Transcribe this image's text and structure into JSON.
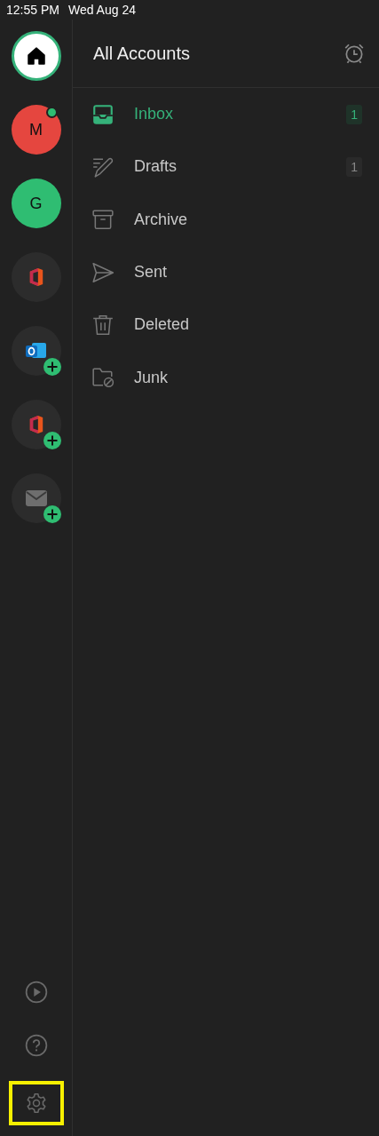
{
  "status_bar": {
    "time": "12:55 PM",
    "date": "Wed Aug 24"
  },
  "accounts": [
    {
      "kind": "home",
      "selected": true,
      "add": false,
      "unread": false
    },
    {
      "kind": "letter",
      "letter": "M",
      "color": "#e5463f",
      "selected": false,
      "add": false,
      "unread": true
    },
    {
      "kind": "letter",
      "letter": "G",
      "color": "#2fbd72",
      "selected": false,
      "add": false,
      "unread": false
    },
    {
      "kind": "office",
      "selected": false,
      "add": false,
      "unread": false
    },
    {
      "kind": "outlook",
      "selected": false,
      "add": true,
      "unread": false
    },
    {
      "kind": "office",
      "selected": false,
      "add": true,
      "unread": false
    },
    {
      "kind": "mail",
      "selected": false,
      "add": true,
      "unread": false
    }
  ],
  "rail_tools": [
    {
      "kind": "play",
      "highlighted": false
    },
    {
      "kind": "help",
      "highlighted": false
    },
    {
      "kind": "settings",
      "highlighted": true
    }
  ],
  "header": {
    "title": "All Accounts"
  },
  "folders": [
    {
      "kind": "inbox",
      "label": "Inbox",
      "count": "1",
      "selected": true
    },
    {
      "kind": "drafts",
      "label": "Drafts",
      "count": "1",
      "selected": false
    },
    {
      "kind": "archive",
      "label": "Archive",
      "selected": false
    },
    {
      "kind": "sent",
      "label": "Sent",
      "selected": false
    },
    {
      "kind": "deleted",
      "label": "Deleted",
      "selected": false
    },
    {
      "kind": "junk",
      "label": "Junk",
      "selected": false
    }
  ]
}
